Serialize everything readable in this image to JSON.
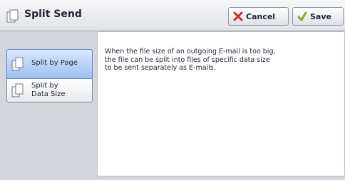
{
  "header": {
    "title": "Split Send",
    "cancel_label": "Cancel",
    "save_label": "Save"
  },
  "options": [
    {
      "label": "Split by Page",
      "selected": true
    },
    {
      "label_line1": "Split by",
      "label_line2": "Data Size",
      "selected": false
    }
  ],
  "description": {
    "line1": "When the file size of an outgoing E-mail is too big,",
    "line2": "the file can be split into files of specific data size",
    "line3": "to be sent separately as E-mails."
  },
  "colors": {
    "selected_bg": "#9fbff0",
    "cancel_x": "#d42a1f",
    "save_check": "#79b21c"
  },
  "icons": {
    "title": "pages-icon",
    "cancel": "x-icon",
    "save": "checkmark-icon",
    "split_by_page": "page-split-icon",
    "split_by_data_size": "data-split-icon"
  }
}
